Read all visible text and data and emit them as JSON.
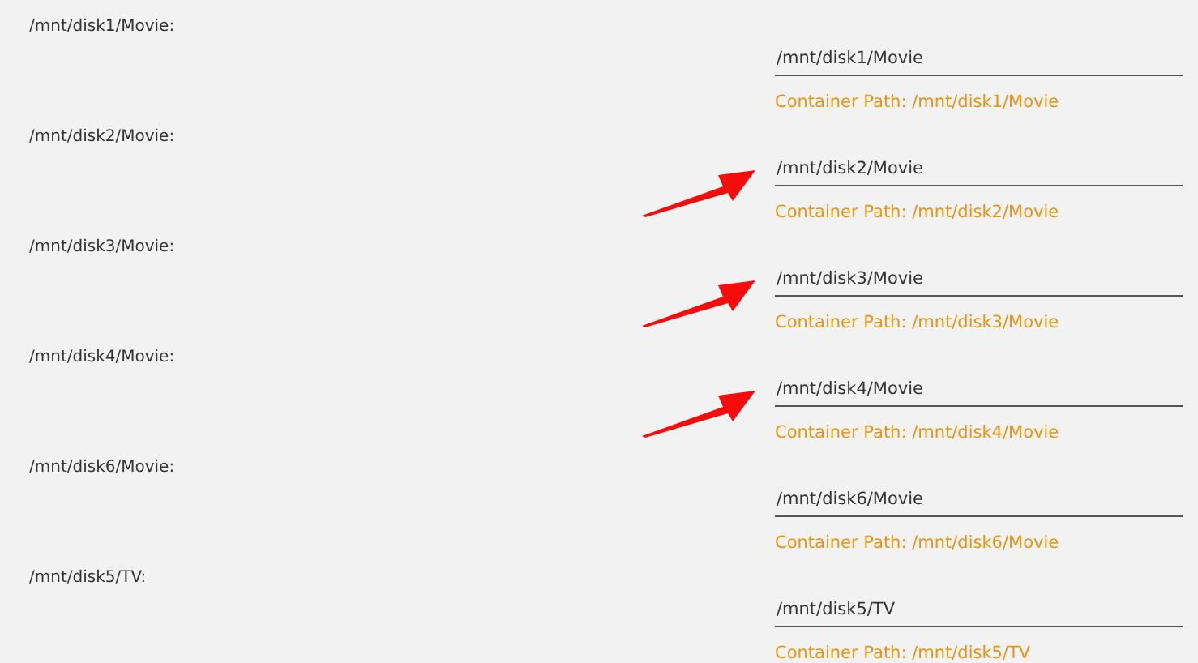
{
  "mappings": [
    {
      "label": "/mnt/disk1/Movie:",
      "value": "/mnt/disk1/Movie",
      "hint": "Container Path: /mnt/disk1/Movie",
      "arrow": false
    },
    {
      "label": "/mnt/disk2/Movie:",
      "value": "/mnt/disk2/Movie",
      "hint": "Container Path: /mnt/disk2/Movie",
      "arrow": true
    },
    {
      "label": "/mnt/disk3/Movie:",
      "value": "/mnt/disk3/Movie",
      "hint": "Container Path: /mnt/disk3/Movie",
      "arrow": true
    },
    {
      "label": "/mnt/disk4/Movie:",
      "value": "/mnt/disk4/Movie",
      "hint": "Container Path: /mnt/disk4/Movie",
      "arrow": true
    },
    {
      "label": "/mnt/disk6/Movie:",
      "value": "/mnt/disk6/Movie",
      "hint": "Container Path: /mnt/disk6/Movie",
      "arrow": false
    },
    {
      "label": "/mnt/disk5/TV:",
      "value": "/mnt/disk5/TV",
      "hint": "Container Path: /mnt/disk5/TV",
      "arrow": false
    }
  ]
}
